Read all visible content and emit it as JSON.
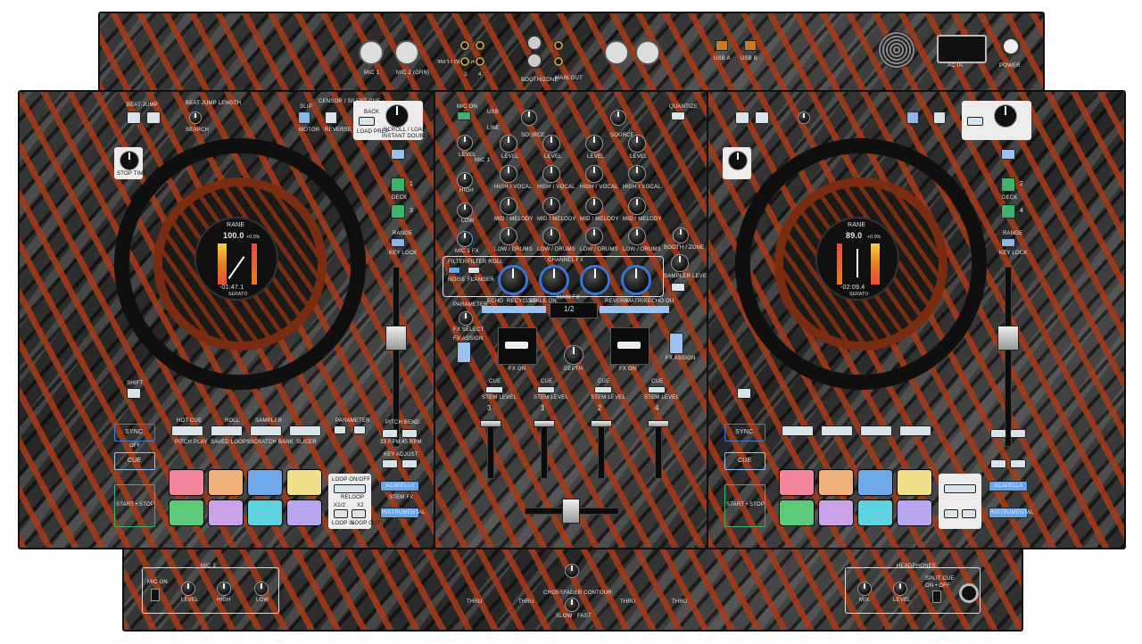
{
  "rear_panel": {
    "mic1": "MIC 1",
    "mic2": "MIC 2 (GRN)",
    "phono_line": "PHONO / LINE",
    "ch3": "3",
    "ch4": "4",
    "booth_zone": "BOOTH/ZONE",
    "main_out": "MAIN OUT",
    "usb_a": "USB A",
    "usb_b": "USB B",
    "ac_in": "AC IN",
    "power": "POWER"
  },
  "mixer": {
    "mic_on": "MIC ON",
    "usb": "USB",
    "line": "LINE",
    "source": "SOURCE",
    "level": "LEVEL",
    "mic1": "MIC 1",
    "high": "HIGH",
    "low": "LOW",
    "high_vocal": "HIGH / VOCAL",
    "mid_melody": "MID / MELODY",
    "low_drums": "LOW / DRUMS",
    "mic_fx": "MIC 1 FX",
    "booth_zone": "BOOTH / ZONE",
    "quantize": "QUANTIZE",
    "sampler_level": "SAMPLER LEVEL",
    "filter": "FILTER",
    "filter_roll": "FILTER ROLL",
    "noise": "NOISE",
    "flanger": "FLANGER",
    "channel_fx": "CHANNEL FX",
    "parameter": "PARAMETER",
    "fx_select": "FX SELECT",
    "fx_assign": "FX ASSIGN",
    "fx_on": "FX ON",
    "main_fx": "MAIN FX",
    "echo": "ECHO",
    "recycler": "RECYCLER",
    "scale_on": "SCALE ON",
    "reverb": "REVERB",
    "matrix": "MATRIX",
    "echo_out": "ECHO OU",
    "depth": "DEPTH",
    "beat_display": "1/2",
    "cue": "CUE",
    "stem_level": "STEM LEVEL",
    "channels": [
      "3",
      "1",
      "2",
      "4"
    ],
    "thru": "THRU",
    "crossfader_contour": "CROSSFADER CONTOUR",
    "slow": "SLOW",
    "fast": "FAST"
  },
  "left_deck": {
    "beat_jump": "BEAT JUMP",
    "beat_jump_length": "BEAT JUMP LENGTH",
    "search": "SEARCH",
    "slip": "SLIP",
    "motor": "MOTOR",
    "censor": "CENSOR / SILENT CUE",
    "reverse": "REVERSE",
    "back": "BACK",
    "load_prep": "LOAD PREP",
    "scroll_load": "SCROLL / LOAD",
    "instant_double": "INSTANT DOUBLE",
    "stop_time": "STOP TIME",
    "deck": "DECK",
    "deck_nums": [
      "1",
      "3"
    ],
    "range": "RANGE",
    "key_lock": "KEY LOCK",
    "shift": "SHIFT",
    "sync": "SYNC",
    "off": "OFF",
    "cue": "CUE",
    "start_stop": "START • STOP",
    "hot_cue": "HOT CUE",
    "roll": "ROLL",
    "sampler": "SAMPLER",
    "parameter": "PARAMETER",
    "pitch_play": "PITCH PLAY",
    "saved_loops": "SAVED LOOPS",
    "scratch_bank": "SCRATCH BANK",
    "slicer": "SLICER",
    "pitch_bend": "PITCH BEND",
    "rpm33": "33 RPM",
    "rpm45": "45 RPM",
    "key_adjust": "KEY ADJUST",
    "loop_onoff": "LOOP ON/OFF",
    "reloop": "RELOOP",
    "half": "x1/2",
    "double": "x2",
    "loop_in": "LOOP IN",
    "loop_out": "LOOP OUT",
    "acapella": "ACAPELLA",
    "instrumental": "INSTRUMENTAL",
    "stem_fx": "STEM FX",
    "screen": {
      "brand": "RANE",
      "bpm": "100.0",
      "pitch": "+0.0%",
      "time": "-01:47.1",
      "logo": "serato"
    }
  },
  "right_deck": {
    "deck_nums": [
      "2",
      "4"
    ],
    "screen": {
      "brand": "RANE",
      "bpm": "89.0",
      "pitch": "+0.0%",
      "time": "-02:09.4",
      "logo": "serato"
    }
  },
  "front_left": {
    "title": "MIC 2",
    "mic_on": "MIC ON",
    "level": "LEVEL",
    "high": "HIGH",
    "low": "LOW"
  },
  "front_right": {
    "title": "HEADPHONES",
    "split_cue": "SPLIT CUE",
    "on_off": "ON • OFF",
    "mix": "MIX",
    "level": "LEVEL"
  },
  "pads_left": [
    "#f3869b",
    "#f0b27a",
    "#6fa8e8",
    "#f0e08a",
    "#5dca7a",
    "#c9a2e8",
    "#5dd3e0",
    "#b9a6ee"
  ],
  "pads_right": [
    "#f3869b",
    "#f0b27a",
    "#6fa8e8",
    "#f0e08a",
    "#5dca7a",
    "#c9a2e8",
    "#5dd3e0",
    "#b9a6ee"
  ],
  "colors": {
    "accent": "#a83a16",
    "led_green": "#3fb36b",
    "led_blue": "#6aa6e6"
  }
}
